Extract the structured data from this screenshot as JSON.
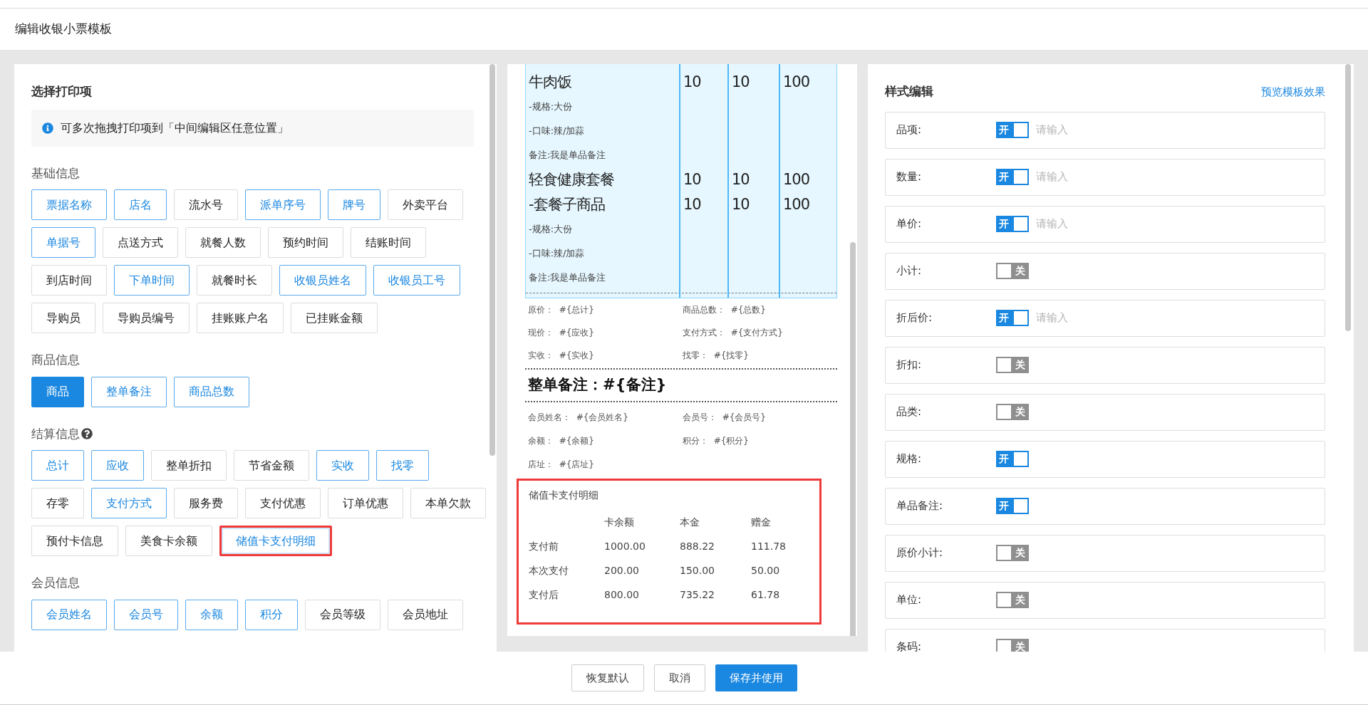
{
  "header": {
    "title": "编辑收银小票模板"
  },
  "print_items": {
    "title": "选择打印项",
    "tip": "可多次拖拽打印项到「中间编辑区任意位置」",
    "groups": [
      {
        "title": "基础信息",
        "items": [
          {
            "label": "票据名称",
            "selected": true,
            "filled": false,
            "highlighted": false
          },
          {
            "label": "店名",
            "selected": true,
            "filled": false,
            "highlighted": false
          },
          {
            "label": "流水号",
            "selected": false,
            "filled": false,
            "highlighted": false
          },
          {
            "label": "派单序号",
            "selected": true,
            "filled": false,
            "highlighted": false
          },
          {
            "label": "牌号",
            "selected": true,
            "filled": false,
            "highlighted": false
          },
          {
            "label": "外卖平台",
            "selected": false,
            "filled": false,
            "highlighted": false
          },
          {
            "label": "单据号",
            "selected": true,
            "filled": false,
            "highlighted": false
          },
          {
            "label": "点送方式",
            "selected": false,
            "filled": false,
            "highlighted": false
          },
          {
            "label": "就餐人数",
            "selected": false,
            "filled": false,
            "highlighted": false
          },
          {
            "label": "预约时间",
            "selected": false,
            "filled": false,
            "highlighted": false
          },
          {
            "label": "结账时间",
            "selected": false,
            "filled": false,
            "highlighted": false
          },
          {
            "label": "到店时间",
            "selected": false,
            "filled": false,
            "highlighted": false
          },
          {
            "label": "下单时间",
            "selected": true,
            "filled": false,
            "highlighted": false
          },
          {
            "label": "就餐时长",
            "selected": false,
            "filled": false,
            "highlighted": false
          },
          {
            "label": "收银员姓名",
            "selected": true,
            "filled": false,
            "highlighted": false
          },
          {
            "label": "收银员工号",
            "selected": true,
            "filled": false,
            "highlighted": false
          },
          {
            "label": "导购员",
            "selected": false,
            "filled": false,
            "highlighted": false
          },
          {
            "label": "导购员编号",
            "selected": false,
            "filled": false,
            "highlighted": false
          },
          {
            "label": "挂账账户名",
            "selected": false,
            "filled": false,
            "highlighted": false
          },
          {
            "label": "已挂账金额",
            "selected": false,
            "filled": false,
            "highlighted": false
          }
        ]
      },
      {
        "title": "商品信息",
        "items": [
          {
            "label": "商品",
            "selected": true,
            "filled": true,
            "highlighted": false
          },
          {
            "label": "整单备注",
            "selected": true,
            "filled": false,
            "highlighted": false
          },
          {
            "label": "商品总数",
            "selected": true,
            "filled": false,
            "highlighted": false
          }
        ]
      },
      {
        "title": "结算信息",
        "help": true,
        "items": [
          {
            "label": "总计",
            "selected": true,
            "filled": false,
            "highlighted": false
          },
          {
            "label": "应收",
            "selected": true,
            "filled": false,
            "highlighted": false
          },
          {
            "label": "整单折扣",
            "selected": false,
            "filled": false,
            "highlighted": false
          },
          {
            "label": "节省金额",
            "selected": false,
            "filled": false,
            "highlighted": false
          },
          {
            "label": "实收",
            "selected": true,
            "filled": false,
            "highlighted": false
          },
          {
            "label": "找零",
            "selected": true,
            "filled": false,
            "highlighted": false
          },
          {
            "label": "存零",
            "selected": false,
            "filled": false,
            "highlighted": false
          },
          {
            "label": "支付方式",
            "selected": true,
            "filled": false,
            "highlighted": false
          },
          {
            "label": "服务费",
            "selected": false,
            "filled": false,
            "highlighted": false
          },
          {
            "label": "支付优惠",
            "selected": false,
            "filled": false,
            "highlighted": false
          },
          {
            "label": "订单优惠",
            "selected": false,
            "filled": false,
            "highlighted": false
          },
          {
            "label": "本单欠款",
            "selected": false,
            "filled": false,
            "highlighted": false
          },
          {
            "label": "预付卡信息",
            "selected": false,
            "filled": false,
            "highlighted": false
          },
          {
            "label": "美食卡余额",
            "selected": false,
            "filled": false,
            "highlighted": false
          },
          {
            "label": "储值卡支付明细",
            "selected": true,
            "filled": false,
            "highlighted": true
          }
        ]
      },
      {
        "title": "会员信息",
        "items": [
          {
            "label": "会员姓名",
            "selected": true,
            "filled": false,
            "highlighted": false
          },
          {
            "label": "会员号",
            "selected": true,
            "filled": false,
            "highlighted": false
          },
          {
            "label": "余额",
            "selected": true,
            "filled": false,
            "highlighted": false
          },
          {
            "label": "积分",
            "selected": true,
            "filled": false,
            "highlighted": false
          },
          {
            "label": "会员等级",
            "selected": false,
            "filled": false,
            "highlighted": false
          },
          {
            "label": "会员地址",
            "selected": false,
            "filled": false,
            "highlighted": false
          }
        ]
      }
    ]
  },
  "receipt": {
    "product_lines": [
      {
        "kind": "main",
        "name": "牛肉饭",
        "qty": "10",
        "price": "10",
        "amount": "100"
      },
      {
        "kind": "detail",
        "text": "-规格:大份"
      },
      {
        "kind": "detail",
        "text": "-口味:辣/加蒜"
      },
      {
        "kind": "detail",
        "text": "备注:我是单品备注"
      },
      {
        "kind": "main",
        "name": "轻食健康套餐",
        "qty": "10",
        "price": "10",
        "amount": "100"
      },
      {
        "kind": "main",
        "name": "-套餐子商品",
        "qty": "10",
        "price": "10",
        "amount": "100"
      },
      {
        "kind": "detail",
        "text": "-规格:大份"
      },
      {
        "kind": "detail",
        "text": "-口味:辣/加蒜"
      },
      {
        "kind": "detail",
        "text": "备注:我是单品备注"
      }
    ],
    "totals": [
      "原价：  #{总计}",
      "商品总数：  #{总数}",
      "现价：  #{应收}",
      "支付方式：  #{支付方式}",
      "实收：  #{实收}",
      "找零：  #{找零}"
    ],
    "order_note": "整单备注：#{备注}",
    "member_fields": [
      "会员姓名：  #{会员姓名}",
      "会员号：  #{会员号}",
      "余额：  #{余额}",
      "积分：  #{积分}",
      "店址：  #{店址}"
    ],
    "stored_value": {
      "title": "储值卡支付明细",
      "highlighted": true,
      "columns": [
        "卡余额",
        "本金",
        "赠金"
      ],
      "rows": [
        {
          "label": "支付前",
          "values": [
            "1000.00",
            "888.22",
            "111.78"
          ]
        },
        {
          "label": "本次支付",
          "values": [
            "200.00",
            "150.00",
            "50.00"
          ]
        },
        {
          "label": "支付后",
          "values": [
            "800.00",
            "735.22",
            "61.78"
          ]
        }
      ]
    }
  },
  "style_editor": {
    "title": "样式编辑",
    "link": "预览模板效果",
    "rows": [
      {
        "label": "品项:",
        "on": true,
        "switch_text": "开",
        "placeholder": "请输入"
      },
      {
        "label": "数量:",
        "on": true,
        "switch_text": "开",
        "placeholder": "请输入"
      },
      {
        "label": "单价:",
        "on": true,
        "switch_text": "开",
        "placeholder": "请输入"
      },
      {
        "label": "小计:",
        "on": false,
        "switch_text": "关"
      },
      {
        "label": "折后价:",
        "on": true,
        "switch_text": "开",
        "placeholder": "请输入"
      },
      {
        "label": "折扣:",
        "on": false,
        "switch_text": "关"
      },
      {
        "label": "品类:",
        "on": false,
        "switch_text": "关"
      },
      {
        "label": "规格:",
        "on": true,
        "switch_text": "开"
      },
      {
        "label": "单品备注:",
        "on": true,
        "switch_text": "开"
      },
      {
        "label": "原价小计:",
        "on": false,
        "switch_text": "关"
      },
      {
        "label": "单位:",
        "on": false,
        "switch_text": "关"
      },
      {
        "label": "条码:",
        "on": false,
        "switch_text": "关"
      }
    ]
  },
  "footer": {
    "buttons": [
      {
        "label": "恢复默认",
        "primary": false
      },
      {
        "label": "取消",
        "primary": false
      },
      {
        "label": "保存并使用",
        "primary": true
      }
    ]
  }
}
